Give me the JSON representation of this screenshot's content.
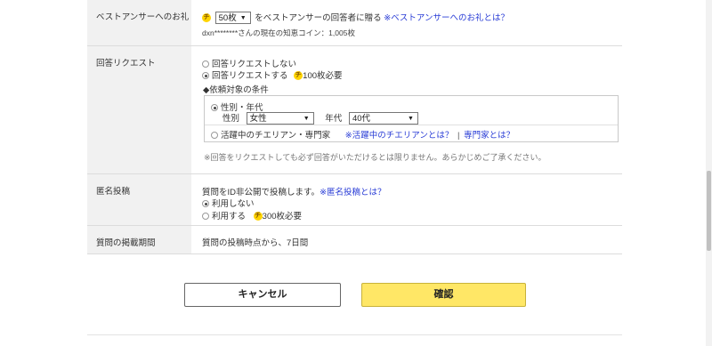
{
  "best_answer": {
    "label": "ベストアンサーへのお礼",
    "coin_icon_text": "チ",
    "selected_amount": "50枚",
    "text_after": "をベストアンサーの回答者に贈る",
    "help_link": "※ベストアンサーへのお礼とは？",
    "balance_text": "dxn********さんの現在の知恵コイン：1,005枚"
  },
  "request": {
    "label": "回答リクエスト",
    "option_no": "回答リクエストしない",
    "option_yes": "回答リクエストする",
    "required_coins": "100枚必要",
    "conditions_heading": "◆依頼対象の条件",
    "gender_age_label": "性別・年代",
    "gender_label": "性別",
    "gender_value": "女性",
    "age_label": "年代",
    "age_value": "40代",
    "expert_label": "活躍中のチエリアン・専門家",
    "expert_help_1": "※活躍中のチエリアンとは？",
    "separator": "|",
    "expert_help_2": "専門家とは？",
    "note": "※回答をリクエストしても必ず回答がいただけるとは限りません。あらかじめご了承ください。"
  },
  "anonymous": {
    "label": "匿名投稿",
    "desc": "質問をID非公開で投稿します。",
    "help_link": "※匿名投稿とは？",
    "option_no": "利用しない",
    "option_yes": "利用する",
    "required_coins": "300枚必要"
  },
  "period": {
    "label": "質問の掲載期間",
    "value": "質問の投稿時点から、7日間"
  },
  "buttons": {
    "cancel": "キャンセル",
    "confirm": "確認"
  },
  "colors": {
    "accent_yellow": "#ffe766",
    "link_blue": "#2a3dd6",
    "label_bg": "#f1f1f1"
  }
}
